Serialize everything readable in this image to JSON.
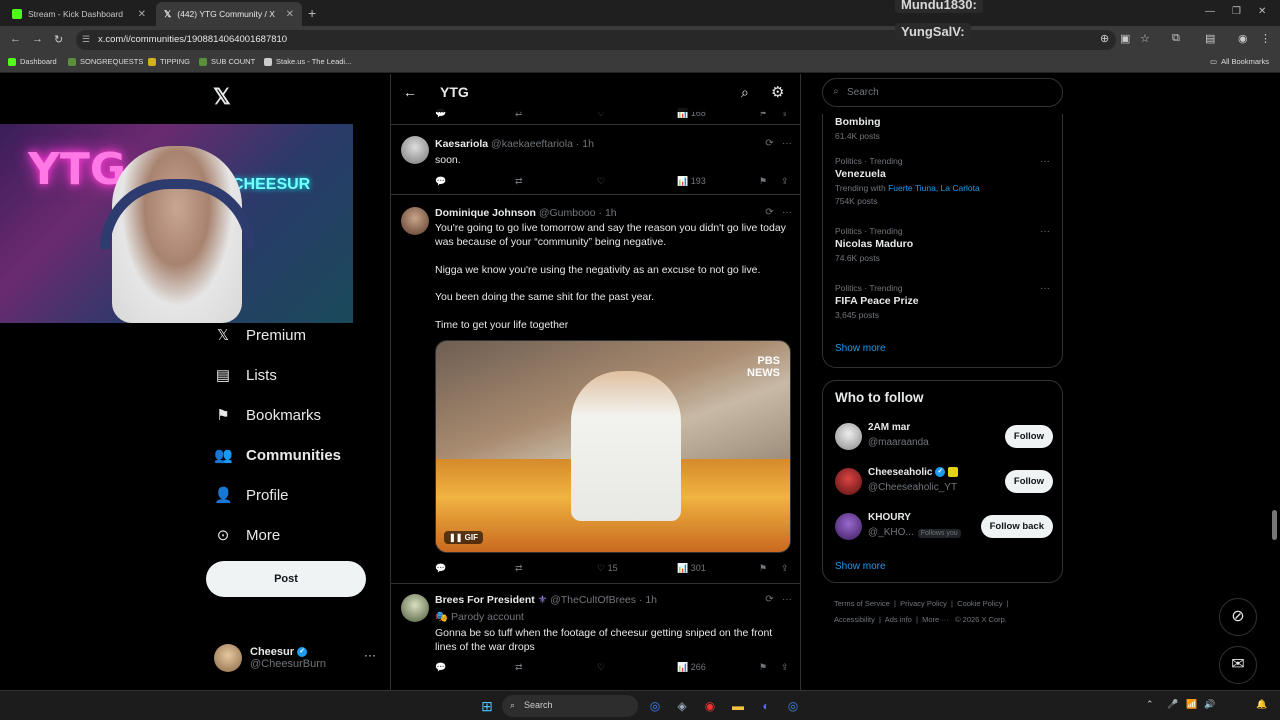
{
  "browser": {
    "tabs": [
      {
        "title": "Stream - Kick Dashboard",
        "favicon_color": "#53fc18"
      },
      {
        "title": "(442) YTG Community / X",
        "favicon_color": "#ffffff"
      }
    ],
    "url": "x.com/i/communities/1908814064001687810",
    "bookmarks": [
      {
        "label": "Dashboard",
        "color": "#53fc18"
      },
      {
        "label": "SONGREQUESTS",
        "color": "#5a8f3c"
      },
      {
        "label": "TIPPING",
        "color": "#d4b21a"
      },
      {
        "label": "SUB COUNT",
        "color": "#5a8f3c"
      },
      {
        "label": "Stake.us - The Leadi...",
        "color": "#cccccc"
      }
    ],
    "all_bookmarks": "All Bookmarks"
  },
  "overlay": {
    "chat1": "Mundu1830:",
    "chat2": "YungSalV:"
  },
  "webcam": {
    "neon_left": "YTG",
    "neon_right": "CHEESUR"
  },
  "sidebar": {
    "items": [
      {
        "label": "Premium",
        "icon": "x-icon"
      },
      {
        "label": "Lists",
        "icon": "list-icon"
      },
      {
        "label": "Bookmarks",
        "icon": "bookmark-icon"
      },
      {
        "label": "Communities",
        "icon": "people-icon"
      },
      {
        "label": "Profile",
        "icon": "person-icon"
      },
      {
        "label": "More",
        "icon": "more-circle-icon"
      }
    ],
    "post_label": "Post",
    "account": {
      "name": "Cheesur",
      "handle": "@CheesurBurn"
    }
  },
  "feed": {
    "title": "YTG",
    "top_partial": {
      "views": "168"
    },
    "tweets": [
      {
        "name": "Kaesariola",
        "handle": "@kaekaeeftariola · 1h",
        "text": "soon.",
        "views": "193"
      },
      {
        "name": "Dominique Johnson",
        "handle": "@Gumbooo · 1h",
        "paragraphs": [
          "You're going to go live tomorrow and say the reason you didn't go live today was because of your “community” being negative.",
          "Nigga we know you're using the negativity as an excuse to not go live.",
          "You been doing the same shit for the past year.",
          "Time to get your life together"
        ],
        "media_badge": "GIF",
        "media_logo_1": "PBS",
        "media_logo_2": "NEWS",
        "likes": "15",
        "views": "301"
      },
      {
        "name": "Brees For President",
        "handle": "@TheCultOfBrees · 1h",
        "label": "Parody account",
        "text": "Gonna be so tuff when the footage of cheesur getting sniped on the front lines of the war drops",
        "views": "266"
      }
    ]
  },
  "right": {
    "search_placeholder": "Search",
    "trends": [
      {
        "category": "",
        "title": "Bombing",
        "sub": "61.4K posts"
      },
      {
        "category": "Politics · Trending",
        "title": "Venezuela",
        "sub_prefix": "Trending with ",
        "sub_links": "Fuerte Tiuna, La Carlota",
        "sub": "754K posts"
      },
      {
        "category": "Politics · Trending",
        "title": "Nicolas Maduro",
        "sub": "74.6K posts"
      },
      {
        "category": "Politics · Trending",
        "title": "FIFA Peace Prize",
        "sub": "3,645 posts"
      }
    ],
    "show_more": "Show more",
    "who_to_follow": "Who to follow",
    "follow": [
      {
        "name": "2AM mar",
        "handle": "@maaraanda",
        "button": "Follow"
      },
      {
        "name": "Cheeseaholic",
        "handle": "@Cheeseaholic_YT",
        "button": "Follow"
      },
      {
        "name": "KHOURY",
        "handle": "@_KHO...",
        "follows_you": "Follows you",
        "button": "Follow back"
      }
    ],
    "footer": [
      "Terms of Service",
      "Privacy Policy",
      "Cookie Policy",
      "Accessibility",
      "Ads info",
      "More ···",
      "© 2026 X Corp."
    ]
  },
  "taskbar": {
    "search": "Search"
  }
}
